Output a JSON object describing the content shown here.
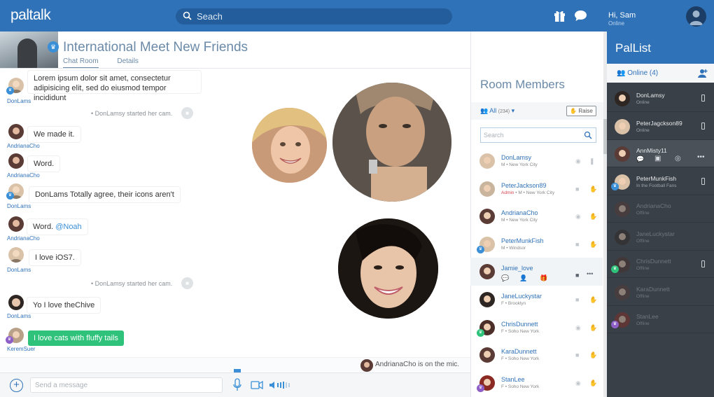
{
  "topbar": {
    "logo": "paltalk",
    "search_placeholder": "Seach",
    "greeting": "Hi, Sam",
    "status": "Online"
  },
  "room": {
    "title": "International Meet New Friends",
    "tabs": [
      {
        "label": "Chat Room"
      },
      {
        "label": "Details"
      }
    ]
  },
  "messages": [
    {
      "user": "DonLams",
      "text": "Lorem ipsum dolor sit amet, consectetur",
      "text2": "adipisicing elit, sed do eiusmod tempor incididunt"
    },
    {
      "system": "DonLamsy started her cam."
    },
    {
      "user": "AndrianaCho",
      "text": "We made it."
    },
    {
      "user": "AndrianaCho",
      "text": "Word."
    },
    {
      "user": "DonLams",
      "text": "DonLams Totally agree, their icons aren't"
    },
    {
      "user": "AndrianaCho",
      "text": "Word.",
      "mention": "@Noah"
    },
    {
      "user": "DonLams",
      "text": "I love iOS7."
    },
    {
      "system": "DonLamsy started her cam."
    },
    {
      "user": "DonLams",
      "text": "Yo I love theChive"
    },
    {
      "user": "KeremSuer",
      "text": "I love cats with fluffy tails"
    }
  ],
  "mic_status": {
    "user": "AndrianaCho",
    "text": "is on the mic."
  },
  "composer": {
    "placeholder": "Send a message"
  },
  "members": {
    "title": "Room Members",
    "filter": "All",
    "count": "(234)",
    "raise": "Raise",
    "search_placeholder": "Search",
    "list": [
      {
        "name": "DonLamsy",
        "sub": "M • New York City"
      },
      {
        "name": "PeterJackson89",
        "role": "Admin",
        "sub": " • M • New York City"
      },
      {
        "name": "AndrianaCho",
        "sub": "M • New York City"
      },
      {
        "name": "PeterMunkFish",
        "sub": "M • Windsor"
      },
      {
        "name": "Jamie_love",
        "sub": ""
      },
      {
        "name": "JaneLuckystar",
        "sub": "F • Brooklyn"
      },
      {
        "name": "ChrisDunnett",
        "sub": "F • Soho New York"
      },
      {
        "name": "KaraDunnett",
        "sub": "F • Soho New York"
      },
      {
        "name": "StanLee",
        "sub": "F • Soho New York"
      }
    ]
  },
  "pallist": {
    "title": "PalList",
    "online_label": "Online (4)",
    "list": [
      {
        "name": "DonLamsy",
        "sub": "Online"
      },
      {
        "name": "PeterJagckson89",
        "sub": "Online"
      },
      {
        "name": "AnnMisty11",
        "sub": ""
      },
      {
        "name": "PeterMunkFish",
        "sub": "In the Football Fans"
      },
      {
        "name": "AndrianaCho",
        "sub": "Offline"
      },
      {
        "name": "JaneLuckystar",
        "sub": "Offline"
      },
      {
        "name": "ChrisDunnett",
        "sub": "Offline"
      },
      {
        "name": "KaraDunnett",
        "sub": "Offline"
      },
      {
        "name": "StanLee",
        "sub": "Offline"
      }
    ]
  },
  "colors": {
    "brand": "#2f72b8",
    "accent_green": "#2ec27a",
    "sidebar": "#3a4047"
  }
}
